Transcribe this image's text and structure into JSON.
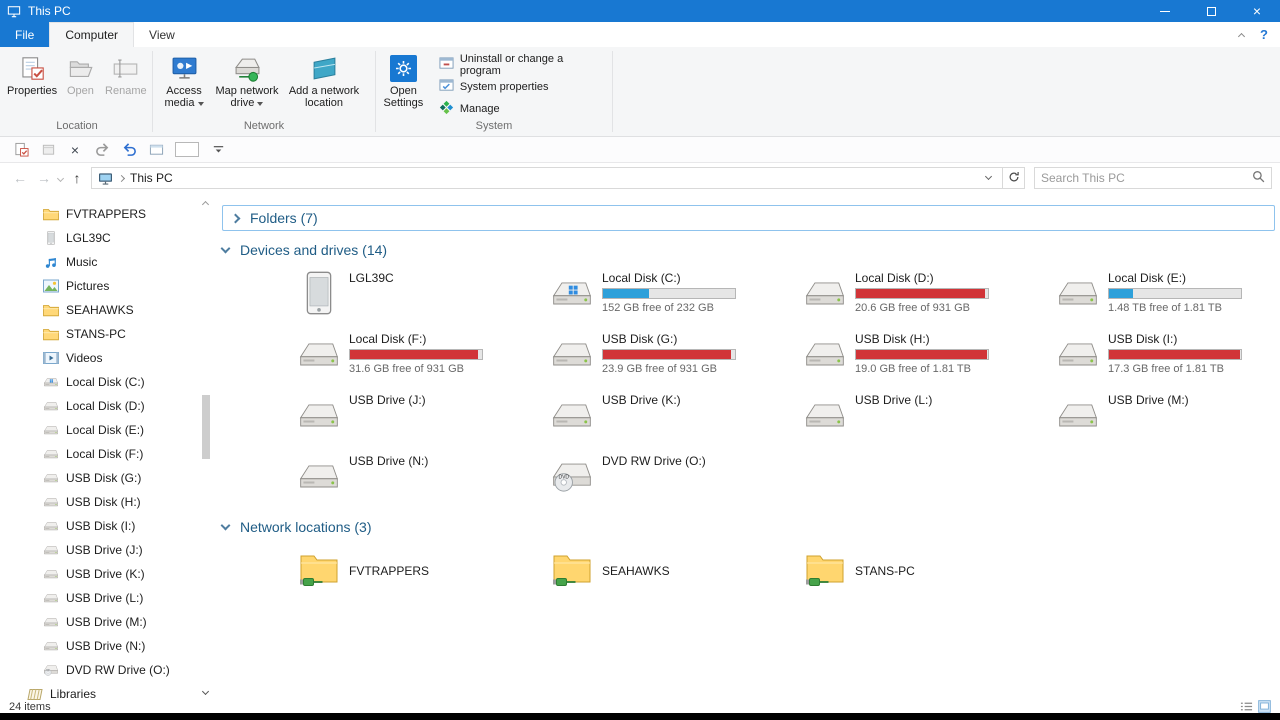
{
  "window": {
    "title": "This PC"
  },
  "colors": {
    "accent": "#1878d2",
    "bar_blue": "#2da0da",
    "bar_red": "#d13438"
  },
  "menu": {
    "tabs": [
      {
        "label": "File"
      },
      {
        "label": "Computer"
      },
      {
        "label": "View"
      }
    ]
  },
  "ribbon": {
    "location": {
      "label": "Location",
      "properties": "Properties",
      "open": "Open",
      "rename": "Rename"
    },
    "network": {
      "label": "Network",
      "access_media": "Access media",
      "map_drive": "Map network drive",
      "add_location": "Add a network location"
    },
    "system": {
      "label": "System",
      "open_settings": "Open Settings",
      "uninstall": "Uninstall or change a program",
      "system_properties": "System properties",
      "manage": "Manage"
    }
  },
  "address": {
    "breadcrumb": "This PC",
    "search_placeholder": "Search This PC"
  },
  "sidebar": {
    "items": [
      {
        "label": "FVTRAPPERS",
        "icon": "folder"
      },
      {
        "label": "LGL39C",
        "icon": "phone"
      },
      {
        "label": "Music",
        "icon": "music"
      },
      {
        "label": "Pictures",
        "icon": "pictures"
      },
      {
        "label": "SEAHAWKS",
        "icon": "folder"
      },
      {
        "label": "STANS-PC",
        "icon": "folder"
      },
      {
        "label": "Videos",
        "icon": "videos"
      },
      {
        "label": "Local Disk (C:)",
        "icon": "drive-win"
      },
      {
        "label": "Local Disk (D:)",
        "icon": "drive"
      },
      {
        "label": "Local Disk (E:)",
        "icon": "drive"
      },
      {
        "label": "Local Disk (F:)",
        "icon": "drive"
      },
      {
        "label": "USB Disk (G:)",
        "icon": "drive"
      },
      {
        "label": "USB Disk (H:)",
        "icon": "drive"
      },
      {
        "label": "USB Disk (I:)",
        "icon": "drive"
      },
      {
        "label": "USB Drive (J:)",
        "icon": "drive"
      },
      {
        "label": "USB Drive (K:)",
        "icon": "drive"
      },
      {
        "label": "USB Drive (L:)",
        "icon": "drive"
      },
      {
        "label": "USB Drive (M:)",
        "icon": "drive"
      },
      {
        "label": "USB Drive (N:)",
        "icon": "drive"
      },
      {
        "label": "DVD RW Drive (O:)",
        "icon": "dvd"
      },
      {
        "label": "Libraries",
        "icon": "libraries",
        "root": true
      }
    ]
  },
  "content": {
    "groups": {
      "folders": "Folders (7)",
      "devices": "Devices and drives (14)",
      "network": "Network locations (3)"
    },
    "drives": [
      {
        "name": "LGL39C",
        "icon": "phone"
      },
      {
        "name": "Local Disk (C:)",
        "icon": "drive-win",
        "detail": "152 GB free of 232 GB",
        "used_pct": 35,
        "bar": "blue"
      },
      {
        "name": "Local Disk (D:)",
        "icon": "drive",
        "detail": "20.6 GB free of 931 GB",
        "used_pct": 98,
        "bar": "red"
      },
      {
        "name": "Local Disk (E:)",
        "icon": "drive",
        "detail": "1.48 TB free of 1.81 TB",
        "used_pct": 18,
        "bar": "blue"
      },
      {
        "name": "Local Disk (F:)",
        "icon": "drive",
        "detail": "31.6 GB free of 931 GB",
        "used_pct": 97,
        "bar": "red"
      },
      {
        "name": "USB Disk (G:)",
        "icon": "drive",
        "detail": "23.9 GB free of 931 GB",
        "used_pct": 97,
        "bar": "red"
      },
      {
        "name": "USB Disk (H:)",
        "icon": "drive",
        "detail": "19.0 GB free of 1.81 TB",
        "used_pct": 99,
        "bar": "red"
      },
      {
        "name": "USB Disk (I:)",
        "icon": "drive",
        "detail": "17.3 GB free of 1.81 TB",
        "used_pct": 99,
        "bar": "red"
      },
      {
        "name": "USB Drive (J:)",
        "icon": "drive"
      },
      {
        "name": "USB Drive (K:)",
        "icon": "drive"
      },
      {
        "name": "USB Drive (L:)",
        "icon": "drive"
      },
      {
        "name": "USB Drive (M:)",
        "icon": "drive"
      },
      {
        "name": "USB Drive (N:)",
        "icon": "drive"
      },
      {
        "name": "DVD RW Drive (O:)",
        "icon": "dvd"
      }
    ],
    "network_locations": [
      {
        "name": "FVTRAPPERS",
        "icon": "net-folder"
      },
      {
        "name": "SEAHAWKS",
        "icon": "net-folder"
      },
      {
        "name": "STANS-PC",
        "icon": "net-folder"
      }
    ]
  },
  "statusbar": {
    "count": "24 items"
  }
}
